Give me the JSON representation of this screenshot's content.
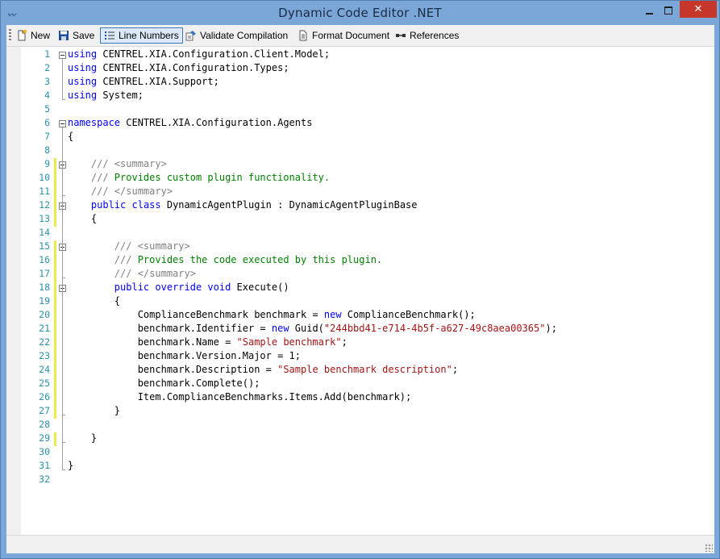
{
  "window": {
    "title": "Dynamic Code Editor .NET",
    "close_glyph": "✕"
  },
  "toolbar": {
    "new_label": "New",
    "save_label": "Save",
    "line_numbers_label": "Line Numbers",
    "validate_label": "Validate Compilation",
    "format_label": "Format Document",
    "references_label": "References"
  },
  "colors": {
    "keyword": "#0000ff",
    "comment": "#008000",
    "doc_tag": "#808080",
    "string": "#a31515",
    "line_number": "#2b91af",
    "changed_margin": "#ecec4a"
  },
  "icons": [
    "new-document-icon",
    "save-disk-icon",
    "line-numbers-icon",
    "validate-icon",
    "format-document-icon",
    "references-icon"
  ],
  "editor": {
    "lines": [
      {
        "n": "1",
        "tokens": [
          {
            "t": "using",
            "c": "kw"
          },
          {
            "t": " CENTREL.XIA.Configuration.Client.Model;"
          }
        ]
      },
      {
        "n": "2",
        "tokens": [
          {
            "t": "using",
            "c": "kw"
          },
          {
            "t": " CENTREL.XIA.Configuration.Types;"
          }
        ]
      },
      {
        "n": "3",
        "tokens": [
          {
            "t": "using",
            "c": "kw"
          },
          {
            "t": " CENTREL.XIA.Support;"
          }
        ]
      },
      {
        "n": "4",
        "tokens": [
          {
            "t": "using",
            "c": "kw"
          },
          {
            "t": " System;"
          }
        ]
      },
      {
        "n": "5",
        "tokens": []
      },
      {
        "n": "6",
        "tokens": [
          {
            "t": "namespace",
            "c": "kw"
          },
          {
            "t": " CENTREL.XIA.Configuration.Agents"
          }
        ]
      },
      {
        "n": "7",
        "tokens": [
          {
            "t": "{"
          }
        ]
      },
      {
        "n": "8",
        "tokens": []
      },
      {
        "n": "9",
        "tokens": [
          {
            "t": "    /// ",
            "c": "cmg"
          },
          {
            "t": "<summary>",
            "c": "cmg"
          }
        ]
      },
      {
        "n": "10",
        "tokens": [
          {
            "t": "    /// ",
            "c": "cmg"
          },
          {
            "t": "Provides custom plugin functionality.",
            "c": "cm"
          }
        ]
      },
      {
        "n": "11",
        "tokens": [
          {
            "t": "    /// ",
            "c": "cmg"
          },
          {
            "t": "</summary>",
            "c": "cmg"
          }
        ]
      },
      {
        "n": "12",
        "tokens": [
          {
            "t": "    "
          },
          {
            "t": "public",
            "c": "kw"
          },
          {
            "t": " "
          },
          {
            "t": "class",
            "c": "kw"
          },
          {
            "t": " DynamicAgentPlugin : DynamicAgentPluginBase"
          }
        ]
      },
      {
        "n": "13",
        "tokens": [
          {
            "t": "    {"
          }
        ]
      },
      {
        "n": "14",
        "tokens": []
      },
      {
        "n": "15",
        "tokens": [
          {
            "t": "        /// ",
            "c": "cmg"
          },
          {
            "t": "<summary>",
            "c": "cmg"
          }
        ]
      },
      {
        "n": "16",
        "tokens": [
          {
            "t": "        /// ",
            "c": "cmg"
          },
          {
            "t": "Provides the code executed by this plugin.",
            "c": "cm"
          }
        ]
      },
      {
        "n": "17",
        "tokens": [
          {
            "t": "        /// ",
            "c": "cmg"
          },
          {
            "t": "</summary>",
            "c": "cmg"
          }
        ]
      },
      {
        "n": "18",
        "tokens": [
          {
            "t": "        "
          },
          {
            "t": "public",
            "c": "kw"
          },
          {
            "t": " "
          },
          {
            "t": "override",
            "c": "kw"
          },
          {
            "t": " "
          },
          {
            "t": "void",
            "c": "kw"
          },
          {
            "t": " Execute()"
          }
        ]
      },
      {
        "n": "19",
        "tokens": [
          {
            "t": "        {"
          }
        ]
      },
      {
        "n": "20",
        "tokens": [
          {
            "t": "            ComplianceBenchmark benchmark = "
          },
          {
            "t": "new",
            "c": "kw"
          },
          {
            "t": " ComplianceBenchmark();"
          }
        ]
      },
      {
        "n": "21",
        "tokens": [
          {
            "t": "            benchmark.Identifier = "
          },
          {
            "t": "new",
            "c": "kw"
          },
          {
            "t": " Guid("
          },
          {
            "t": "\"244bbd41-e714-4b5f-a627-49c8aea00365\"",
            "c": "str"
          },
          {
            "t": ");"
          }
        ]
      },
      {
        "n": "22",
        "tokens": [
          {
            "t": "            benchmark.Name = "
          },
          {
            "t": "\"Sample benchmark\"",
            "c": "str"
          },
          {
            "t": ";"
          }
        ]
      },
      {
        "n": "23",
        "tokens": [
          {
            "t": "            benchmark.Version.Major = 1;"
          }
        ]
      },
      {
        "n": "24",
        "tokens": [
          {
            "t": "            benchmark.Description = "
          },
          {
            "t": "\"Sample benchmark description\"",
            "c": "str"
          },
          {
            "t": ";"
          }
        ]
      },
      {
        "n": "25",
        "tokens": [
          {
            "t": "            benchmark.Complete();"
          }
        ]
      },
      {
        "n": "26",
        "tokens": [
          {
            "t": "            Item.ComplianceBenchmarks.Items.Add(benchmark);"
          }
        ]
      },
      {
        "n": "27",
        "tokens": [
          {
            "t": "        }"
          }
        ]
      },
      {
        "n": "28",
        "tokens": []
      },
      {
        "n": "29",
        "tokens": [
          {
            "t": "    }"
          }
        ]
      },
      {
        "n": "30",
        "tokens": []
      },
      {
        "n": "31",
        "tokens": [
          {
            "t": "}"
          }
        ]
      },
      {
        "n": "32",
        "tokens": []
      }
    ]
  }
}
